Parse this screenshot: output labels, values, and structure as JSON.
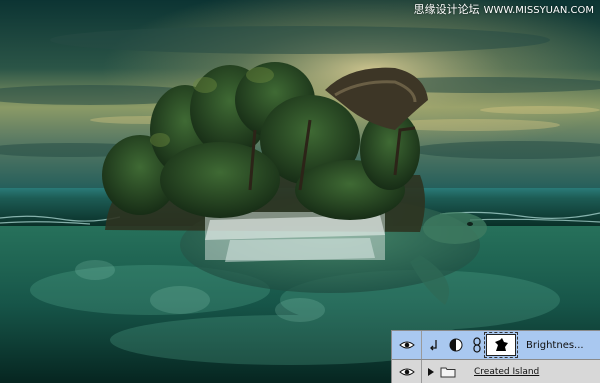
{
  "watermark": {
    "site_cn": "思缘设计论坛",
    "site_url": "WWW.MISSYUAN.COM"
  },
  "layers": {
    "adjustment_layer": {
      "name": "Brightnes...",
      "visible": true,
      "selected": true
    },
    "group_layer": {
      "name": "Created Island",
      "visible": true,
      "expanded": false
    }
  },
  "colors": {
    "selected_row": "#a9c8f0",
    "panel_bg": "#d6d6d6",
    "sky_top": "#0f3a3a",
    "sky_glow": "#c9b46a",
    "sea_deep": "#0a3a30"
  }
}
